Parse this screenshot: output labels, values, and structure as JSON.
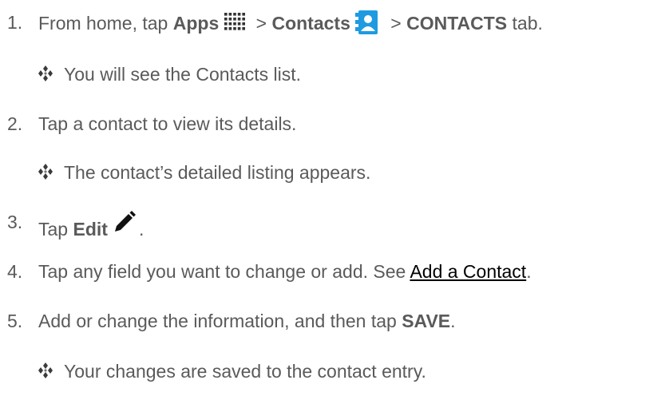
{
  "steps": [
    {
      "num": "1.",
      "pre": "From home, tap ",
      "apps": "Apps",
      "sep1": " > ",
      "contacts": "Contacts",
      "sep2": " > ",
      "tab": "CONTACTS",
      "post": " tab."
    },
    {
      "num": "2.",
      "text": "Tap a contact to view its details."
    },
    {
      "num": "3.",
      "pre": "Tap ",
      "bold": "Edit",
      "post": "."
    },
    {
      "num": "4.",
      "pre": "Tap any field you want to change or add. See ",
      "link": "Add a Contact",
      "post": "."
    },
    {
      "num": "5.",
      "pre": "Add or change the information, and then tap ",
      "bold": "SAVE",
      "post": "."
    }
  ],
  "results": [
    "You will see the Contacts list.",
    "The contact’s detailed listing appears.",
    "Your changes are saved to the contact entry."
  ],
  "icons": {
    "apps": "apps-grid-icon",
    "contacts": "contacts-app-icon",
    "edit": "pencil-icon",
    "bullet": "diamond-bullet-icon"
  },
  "colors": {
    "text": "#5a5a5a",
    "link": "#000000",
    "contacts_icon": "#1e9be0"
  }
}
